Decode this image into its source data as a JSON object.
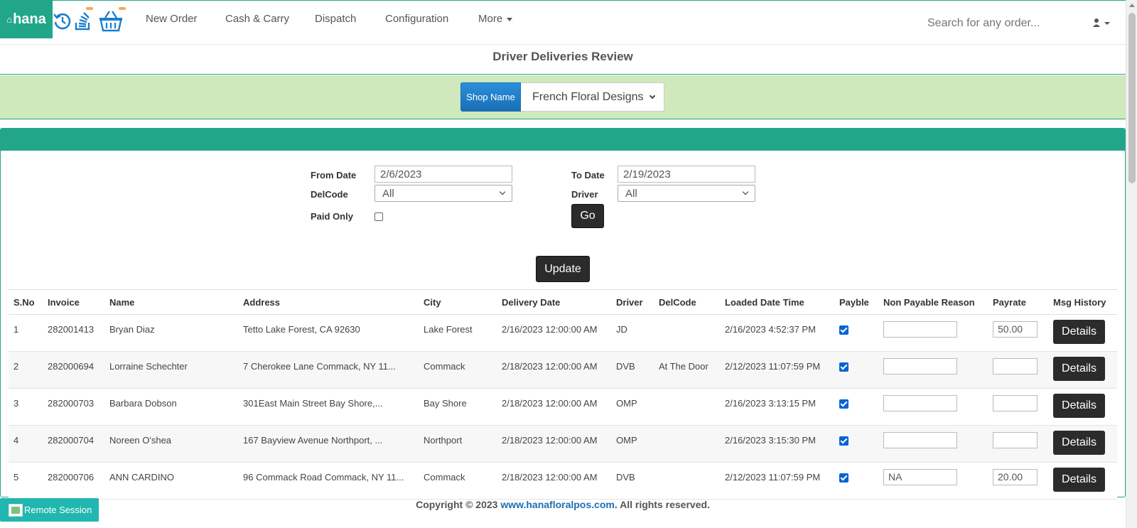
{
  "app": {
    "logo_text": "hana",
    "nav": [
      {
        "label": "New Order"
      },
      {
        "label": "Cash & Carry"
      },
      {
        "label": "Dispatch"
      },
      {
        "label": "Configuration"
      },
      {
        "label": "More"
      }
    ],
    "search_placeholder": "Search for any order..."
  },
  "page": {
    "title": "Driver Deliveries Review",
    "shop_label": "Shop Name",
    "shop_value": "French Floral Designs"
  },
  "filters": {
    "from_label": "From Date",
    "from_value": "2/6/2023",
    "to_label": "To Date",
    "to_value": "2/19/2023",
    "delcode_label": "DelCode",
    "delcode_value": "All",
    "driver_label": "Driver",
    "driver_value": "All",
    "paid_only_label": "Paid Only",
    "paid_only_checked": false,
    "go_label": "Go",
    "update_label": "Update"
  },
  "table": {
    "headers": [
      "S.No",
      "Invoice",
      "Name",
      "Address",
      "City",
      "Delivery Date",
      "Driver",
      "DelCode",
      "Loaded Date Time",
      "Payble",
      "Non Payable Reason",
      "Payrate",
      "Msg History"
    ],
    "rows": [
      {
        "sno": "1",
        "invoice": "282001413",
        "name": "Bryan Diaz",
        "address": "Tetto Lake Forest, CA 92630",
        "city": "Lake Forest",
        "delivery_date": "2/16/2023 12:00:00 AM",
        "driver": "JD",
        "delcode": "",
        "loaded": "2/16/2023 4:52:37 PM",
        "payable": true,
        "reason": "",
        "payrate": "50.00",
        "details": "Details"
      },
      {
        "sno": "2",
        "invoice": "282000694",
        "name": "Lorraine Schechter",
        "address": "7 Cherokee Lane Commack, NY 11...",
        "city": "Commack",
        "delivery_date": "2/18/2023 12:00:00 AM",
        "driver": "DVB",
        "delcode": "At The Door",
        "loaded": "2/12/2023 11:07:59 PM",
        "payable": true,
        "reason": "",
        "payrate": "",
        "details": "Details"
      },
      {
        "sno": "3",
        "invoice": "282000703",
        "name": "Barbara Dobson",
        "address": "301East Main Street Bay Shore,...",
        "city": "Bay Shore",
        "delivery_date": "2/18/2023 12:00:00 AM",
        "driver": "OMP",
        "delcode": "",
        "loaded": "2/16/2023 3:13:15 PM",
        "payable": true,
        "reason": "",
        "payrate": "",
        "details": "Details"
      },
      {
        "sno": "4",
        "invoice": "282000704",
        "name": "Noreen O'shea",
        "address": "167 Bayview Avenue Northport, ...",
        "city": "Northport",
        "delivery_date": "2/18/2023 12:00:00 AM",
        "driver": "OMP",
        "delcode": "",
        "loaded": "2/16/2023 3:15:30 PM",
        "payable": true,
        "reason": "",
        "payrate": "",
        "details": "Details"
      },
      {
        "sno": "5",
        "invoice": "282000706",
        "name": "ANN CARDINO",
        "address": "96 Commack Road Commack, NY 11...",
        "city": "Commack",
        "delivery_date": "2/18/2023 12:00:00 AM",
        "driver": "DVB",
        "delcode": "",
        "loaded": "2/12/2023 11:07:59 PM",
        "payable": true,
        "reason": "NA",
        "payrate": "20.00",
        "details": "Details"
      }
    ]
  },
  "footer": {
    "prefix": "Copyright © 2023 ",
    "link": "www.hanafloralpos.com",
    "suffix": ". All rights reserved."
  },
  "remote_session": "Remote Session",
  "colors": {
    "brand": "#21a68a",
    "shop_band": "#cfe9bd",
    "shop_label": "#1a6fb5",
    "checkbox": "#0a63d4"
  }
}
